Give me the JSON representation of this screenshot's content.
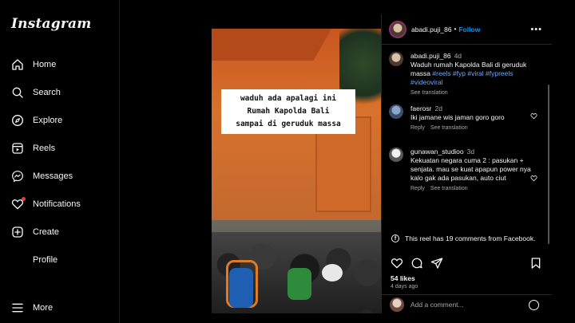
{
  "app": {
    "name": "Instagram"
  },
  "sidebar": {
    "items": [
      {
        "label": "Home",
        "icon": "home-icon"
      },
      {
        "label": "Search",
        "icon": "search-icon"
      },
      {
        "label": "Explore",
        "icon": "compass-icon"
      },
      {
        "label": "Reels",
        "icon": "reels-icon"
      },
      {
        "label": "Messages",
        "icon": "messenger-icon"
      },
      {
        "label": "Notifications",
        "icon": "heart-icon"
      },
      {
        "label": "Create",
        "icon": "plus-square-icon"
      },
      {
        "label": "Profile",
        "icon": "profile-avatar"
      },
      {
        "label": "More",
        "icon": "hamburger-icon"
      }
    ],
    "notification_dot_color": "#ff3040"
  },
  "video": {
    "caption_lines": [
      "waduh ada apalagi ini",
      "Rumah Kapolda Bali",
      "sampai di geruduk massa"
    ],
    "mute_icon": "speaker-muted-icon"
  },
  "post": {
    "username": "abadi.puji_86",
    "follow_label": "Follow",
    "caption": {
      "username": "abadi.puji_86",
      "time": "4d",
      "text": "Waduh rumah Kapolda Bali di geruduk massa",
      "tags": "#reels #fyp #viral #fypreels #videoviral",
      "see_translation": "See translation"
    },
    "comments": [
      {
        "username": "faerosr",
        "time": "2d",
        "text": "Iki jamane wis jaman goro goro",
        "reply": "Reply",
        "see_translation": "See translation"
      },
      {
        "username": "gunawan_studioo",
        "time": "3d",
        "text": "Kekuatan negara cuma 2 : pasukan + senjata. mau se kuat apapun power nya kalo gak ada pasukan, auto ciut",
        "reply": "Reply",
        "see_translation": "See translation"
      }
    ],
    "facebook_note": "This reel has 19 comments from Facebook.",
    "likes": "54 likes",
    "posted_ago": "4 days ago",
    "add_comment_placeholder": "Add a comment..."
  },
  "colors": {
    "accent": "#0095f6",
    "background": "#000000",
    "text": "#f5f5f5",
    "muted": "#a8a8a8"
  }
}
